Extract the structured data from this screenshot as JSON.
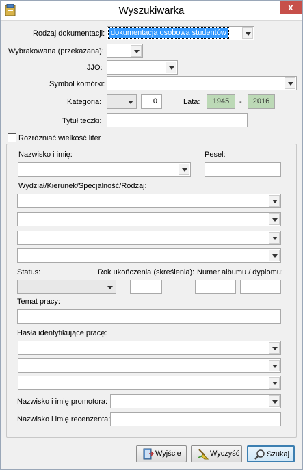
{
  "window": {
    "title": "Wyszukiwarka",
    "close_glyph": "x"
  },
  "form": {
    "rodzaj_label": "Rodzaj dokumentacji:",
    "rodzaj_value": "dokumentacja osobowa studentów",
    "wybrakowana_label": "Wybrakowana (przekazana):",
    "jo_label": "JJO:",
    "symbol_label": "Symbol komórki:",
    "kategoria_label": "Kategoria:",
    "kategoria_num": "0",
    "lata_label": "Lata:",
    "lata_from": "1945",
    "lata_dash": "-",
    "lata_to": "2016",
    "tytul_label": "Tytuł teczki:",
    "case_label": "Rozróżniać wielkość liter"
  },
  "group": {
    "nazwisko_label": "Nazwisko i imię:",
    "pesel_label": "Pesel:",
    "wydzial_label": "Wydział/Kierunek/Specjalność/Rodzaj:",
    "status_label": "Status:",
    "rok_label": "Rok ukończenia (skreślenia):",
    "album_label": "Numer albumu / dyplomu:",
    "temat_label": "Temat pracy:",
    "hasla_label": "Hasła identyfikujące pracę:",
    "promotor_label": "Nazwisko i imię promotora:",
    "recenzent_label": "Nazwisko i imię recenzenta:"
  },
  "buttons": {
    "exit": "Wyjście",
    "clear": "Wyczyść",
    "search": "Szukaj"
  },
  "colors": {
    "selection": "#3399ff",
    "year_field": "#bcd9b6",
    "close": "#c7504a"
  }
}
